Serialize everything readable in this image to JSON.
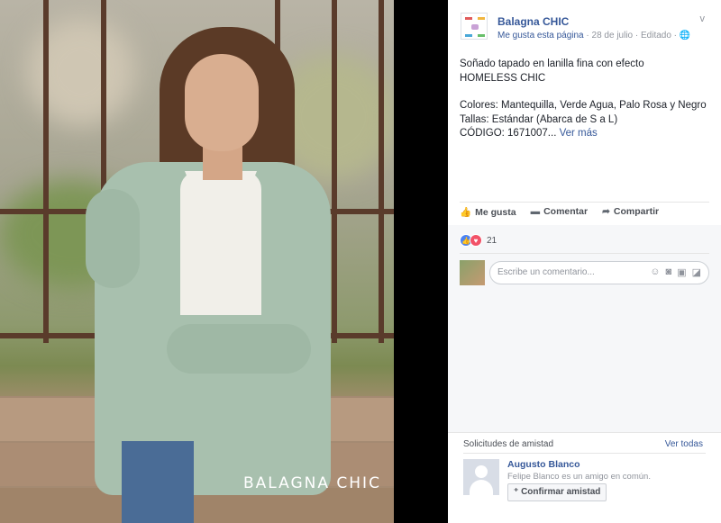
{
  "post": {
    "page_name": "Balagna CHIC",
    "like_page_link": "Me gusta esta página",
    "meta_rest": " · 28 de julio · Editado · ",
    "globe_icon": "🌐",
    "options_icon": "v",
    "text_line1": "Soñado tapado en lanilla fina con efecto",
    "text_line2": "HOMELESS CHIC",
    "text_colors": "Colores: Mantequilla, Verde Agua, Palo Rosa y Negro",
    "text_tallas": "Tallas: Estándar (Abarca de S a L)",
    "text_codigo": "CÓDIGO: 1671007...",
    "see_more": "Ver más"
  },
  "actions": {
    "like_label": "Me gusta",
    "comment_label": "Comentar",
    "share_label": "Compartir"
  },
  "reactions": {
    "count": "21",
    "like_glyph": "👍",
    "love_glyph": "♥"
  },
  "comment": {
    "placeholder": "Escribe un comentario..."
  },
  "friend_requests": {
    "title": "Solicitudes de amistad",
    "see_all": "Ver todas",
    "name": "Augusto Blanco",
    "mutual": "Felipe Blanco es un amigo en común.",
    "confirm_label": "Confirmar amistad"
  },
  "photo": {
    "watermark": "BALAGNA CHIC"
  },
  "colors": {
    "link_blue": "#365899",
    "text_dark": "#1d2129",
    "meta_gray": "#90949c"
  }
}
